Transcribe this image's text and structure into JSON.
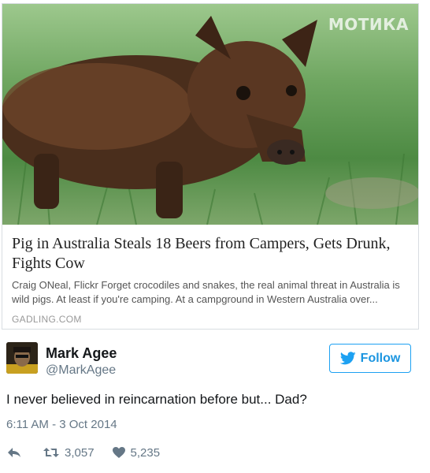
{
  "card": {
    "watermark": "МОТИКА",
    "title": "Pig in Australia Steals 18 Beers from Campers, Gets Drunk, Fights Cow",
    "description": "Craig ONeal, Flickr Forget crocodiles and snakes, the real animal threat in Australia is wild pigs. At least if you're camping. At a campground in Western Australia over...",
    "domain": "GADLING.COM"
  },
  "user": {
    "display_name": "Mark Agee",
    "handle": "@MarkAgee"
  },
  "follow_button": {
    "label": "Follow",
    "icon": "twitter-bird-icon"
  },
  "tweet": {
    "text": "I never believed in reincarnation before but... Dad?",
    "timestamp": "6:11 AM - 3 Oct 2014"
  },
  "actions": {
    "reply": {
      "icon": "reply-icon"
    },
    "retweet": {
      "icon": "retweet-icon",
      "count": "3,057"
    },
    "like": {
      "icon": "heart-icon",
      "count": "5,235"
    }
  },
  "colors": {
    "accent": "#1da1f2",
    "muted": "#657786",
    "text": "#14171a"
  }
}
